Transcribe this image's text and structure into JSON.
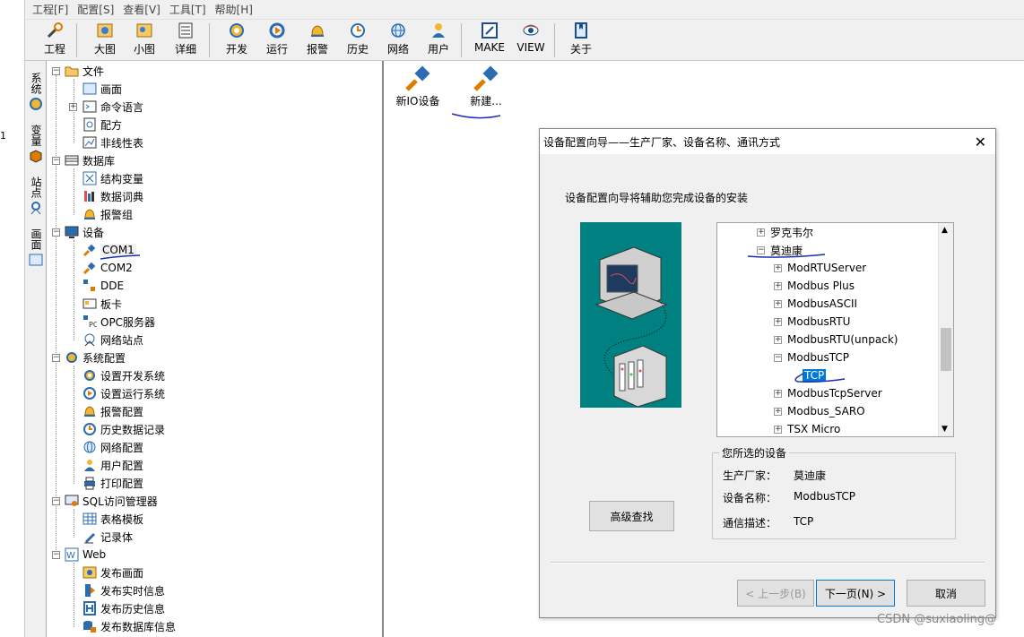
{
  "menu": [
    "工程[F]",
    "配置[S]",
    "查看[V]",
    "工具[T]",
    "帮助[H]"
  ],
  "left_edge_text": "1",
  "toolbar": [
    {
      "label": "工程",
      "icon": "tools-icon"
    },
    {
      "label": "大图",
      "icon": "large-icons-icon"
    },
    {
      "label": "小图",
      "icon": "small-icons-icon"
    },
    {
      "label": "详细",
      "icon": "details-icon"
    },
    {
      "label": "开发",
      "icon": "develop-gear-icon"
    },
    {
      "label": "运行",
      "icon": "run-icon"
    },
    {
      "label": "报警",
      "icon": "alarm-bell-icon"
    },
    {
      "label": "历史",
      "icon": "history-clock-icon"
    },
    {
      "label": "网络",
      "icon": "globe-icon"
    },
    {
      "label": "用户",
      "icon": "user-icon"
    },
    {
      "label": "MAKE",
      "icon": "make-icon"
    },
    {
      "label": "VIEW",
      "icon": "view-eye-icon"
    },
    {
      "label": "关于",
      "icon": "about-book-icon"
    }
  ],
  "vtabs": [
    "系统",
    "变量",
    "站点",
    "画面"
  ],
  "tree": {
    "file": {
      "label": "文件",
      "children": [
        "画面",
        "命令语言",
        "配方",
        "非线性表"
      ]
    },
    "database": {
      "label": "数据库",
      "children": [
        "结构变量",
        "数据词典",
        "报警组"
      ]
    },
    "devices": {
      "label": "设备",
      "children": [
        "COM1",
        "COM2",
        "DDE",
        "板卡",
        "OPC服务器",
        "网络站点"
      ]
    },
    "sysconfig": {
      "label": "系统配置",
      "children": [
        "设置开发系统",
        "设置运行系统",
        "报警配置",
        "历史数据记录",
        "网络配置",
        "用户配置",
        "打印配置"
      ]
    },
    "sql": {
      "label": "SQL访问管理器",
      "children": [
        "表格模板",
        "记录体"
      ]
    },
    "web": {
      "label": "Web",
      "children": [
        "发布画面",
        "发布实时信息",
        "发布历史信息",
        "发布数据库信息"
      ]
    }
  },
  "right_items": [
    "新IO设备",
    "新建..."
  ],
  "dialog": {
    "title": "设备配置向导——生产厂家、设备名称、通讯方式",
    "description": "设备配置向导将辅助您完成设备的安装",
    "tree_items": [
      "罗克韦尔",
      "莫迪康",
      "ModRTUServer",
      "Modbus Plus",
      "ModbusASCII",
      "ModbusRTU",
      "ModbusRTU(unpack)",
      "ModbusTCP",
      "TCP",
      "ModbusTcpServer",
      "Modbus_SARO",
      "TSX Micro"
    ],
    "selected_title": "您所选的设备",
    "manufacturer_label": "生产厂家：",
    "manufacturer_value": "莫迪康",
    "device_label": "设备名称：",
    "device_value": "ModbusTCP",
    "comm_label": "通信描述：",
    "comm_value": "TCP",
    "advanced_button": "高级查找",
    "prev_button": "< 上一步(B)",
    "next_button": "下一页(N) >",
    "cancel_button": "取消"
  },
  "watermark": "CSDN @suxiaoling@"
}
